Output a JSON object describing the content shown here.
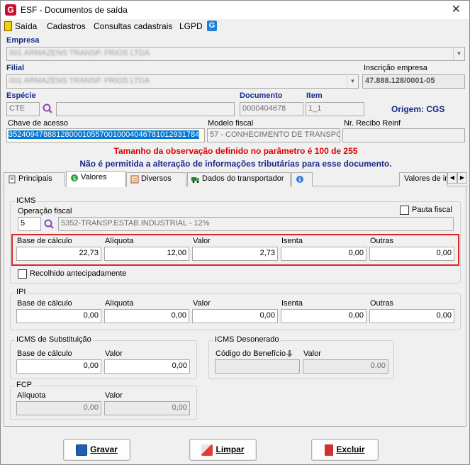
{
  "window": {
    "title": "ESF - Documentos de saída",
    "logo_letter": "G",
    "close": "✕"
  },
  "menu": {
    "items": [
      "Saída",
      "Cadastros",
      "Consultas cadastrais",
      "LGPD"
    ],
    "g_icon": "G"
  },
  "empresa": {
    "label": "Empresa",
    "value": "001 ARMAZENS TRANSP. FRIOS LTDA"
  },
  "filial": {
    "label": "Filial",
    "value": "001 ARMAZENS TRANSP. FRIOS LTDA"
  },
  "inscricao": {
    "label": "Inscrição empresa",
    "value": "47.888.128/0001-05"
  },
  "especie": {
    "label": "Espécie",
    "value": "CTE",
    "desc": ""
  },
  "documento": {
    "label": "Documento",
    "value": "0000404678"
  },
  "item": {
    "label": "Item",
    "value": "1_1"
  },
  "origem": {
    "text": "Origem: CGS"
  },
  "chave": {
    "label": "Chave de acesso",
    "value": "35240947888128000105570010004046781012931784"
  },
  "modelo": {
    "label": "Modelo fiscal",
    "value": "57 - CONHECIMENTO DE TRANSPORTE"
  },
  "recibo": {
    "label": "Nr. Recibo Reinf",
    "value": ""
  },
  "warnings": {
    "line1": "Tamanho da observação definido no parâmetro é 100 de 255",
    "line2": "Não é permitida a alteração de informações tributárias para esse documento."
  },
  "colors": {
    "warn_red": "#e00000",
    "warn_blue": "#1a2a8a",
    "highlight": "#d9262b",
    "select_bg": "#0078d7"
  },
  "tabs": [
    "Principais",
    "Valores",
    "Diversos",
    "Dados do transportador",
    "",
    "Valores de in"
  ],
  "icms": {
    "title": "ICMS",
    "operacao_label": "Operação fiscal",
    "operacao_code": "5",
    "operacao_desc": "5352-TRANSP.ESTAB.INDUSTRIAL - 12%",
    "pauta_label": "Pauta fiscal",
    "cols": [
      "Base de cálculo",
      "Alíquota",
      "Valor",
      "Isenta",
      "Outras"
    ],
    "values": [
      "22,73",
      "12,00",
      "2,73",
      "0,00",
      "0,00"
    ],
    "recolhido_label": "Recolhido antecipadamente"
  },
  "ipi": {
    "title": "IPI",
    "cols": [
      "Base de cálculo",
      "Alíquota",
      "Valor",
      "Isenta",
      "Outras"
    ],
    "values": [
      "0,00",
      "0,00",
      "0,00",
      "0,00",
      "0,00"
    ]
  },
  "icms_st": {
    "title": "ICMS de Substituição",
    "cols": [
      "Base de cálculo",
      "Valor"
    ],
    "values": [
      "0,00",
      "0,00"
    ]
  },
  "icms_des": {
    "title": "ICMS Desonerado",
    "cols": [
      "Código do Benefício",
      "Valor"
    ],
    "values": [
      "",
      "0,00"
    ]
  },
  "fcp": {
    "title": "FCP",
    "cols": [
      "Alíquota",
      "Valor"
    ],
    "values": [
      "0,00",
      "0,00"
    ]
  },
  "buttons": {
    "gravar": "Gravar",
    "limpar": "Limpar",
    "excluir": "Excluir"
  }
}
